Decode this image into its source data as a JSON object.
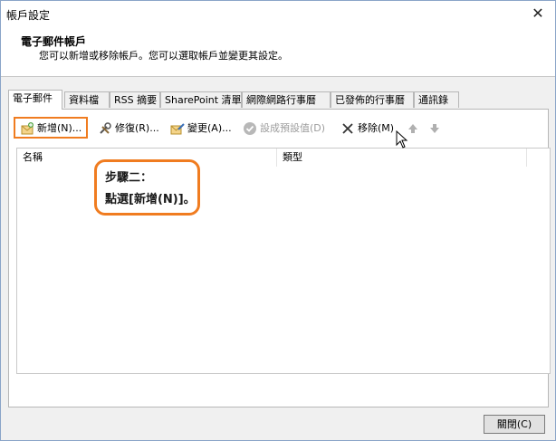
{
  "window": {
    "title": "帳戶設定",
    "close_glyph": "✕"
  },
  "header": {
    "title": "電子郵件帳戶",
    "description": "您可以新增或移除帳戶。您可以選取帳戶並變更其設定。"
  },
  "tabs": [
    {
      "label": "電子郵件"
    },
    {
      "label": "資料檔"
    },
    {
      "label": "RSS 摘要"
    },
    {
      "label": "SharePoint 清單"
    },
    {
      "label": "網際網路行事曆"
    },
    {
      "label": "已發佈的行事曆"
    },
    {
      "label": "通訊錄"
    }
  ],
  "toolbar": {
    "new_label": "新增(N)...",
    "repair_label": "修復(R)...",
    "change_label": "變更(A)...",
    "set_default_label": "設成預設值(D)",
    "remove_label": "移除(M)"
  },
  "list": {
    "columns": [
      "名稱",
      "類型"
    ]
  },
  "callout": {
    "line1": "步驟二：",
    "line2": "點選[新增(N)]。"
  },
  "footer": {
    "close_label": "關閉(C)"
  },
  "colors": {
    "highlight": "#f07c20"
  }
}
